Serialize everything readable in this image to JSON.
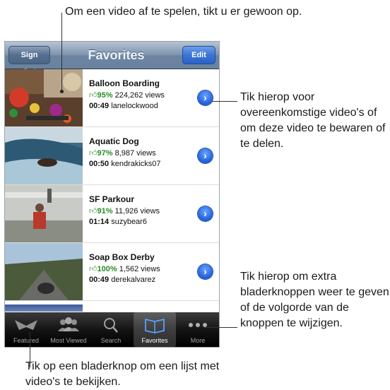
{
  "callouts": {
    "top": "Om een video af te spelen, tikt u er gewoon op.",
    "right_1": "Tik hierop voor overeenkomstige video's of om deze video te bewaren of te delen.",
    "right_2": "Tik hierop om extra bladerknoppen weer te geven of de volgorde van de knoppen te wijzigen.",
    "bottom": "Tik op een bladerknop om een lijst met video's te bekijken."
  },
  "navbar": {
    "left_button": "Sign Out",
    "title": "Favorites",
    "right_button": "Edit"
  },
  "videos": [
    {
      "title": "Balloon Boarding",
      "rating": "95%",
      "views": "224,262 views",
      "duration": "00:49",
      "user": "lanelockwood"
    },
    {
      "title": "Aquatic Dog",
      "rating": "97%",
      "views": "8,987 views",
      "duration": "00:50",
      "user": "kendrakicks07"
    },
    {
      "title": "SF Parkour",
      "rating": "91%",
      "views": "11,926 views",
      "duration": "01:14",
      "user": "suzybear6"
    },
    {
      "title": "Soap Box Derby",
      "rating": "100%",
      "views": "1,562 views",
      "duration": "00:49",
      "user": "derekalvarez"
    }
  ],
  "tabs": [
    {
      "label": "Featured",
      "icon": "featured-icon"
    },
    {
      "label": "Most Viewed",
      "icon": "most-viewed-icon"
    },
    {
      "label": "Search",
      "icon": "search-icon"
    },
    {
      "label": "Favorites",
      "icon": "bookmarks-icon",
      "selected": true
    },
    {
      "label": "More",
      "icon": "more-icon"
    }
  ],
  "colors": {
    "nav_bar": "#6c85a3",
    "edit_button": "#2963c8",
    "disclosure": "#1f5fd6",
    "rating_green": "#2a8a2a",
    "tab_bar": "#141414"
  }
}
